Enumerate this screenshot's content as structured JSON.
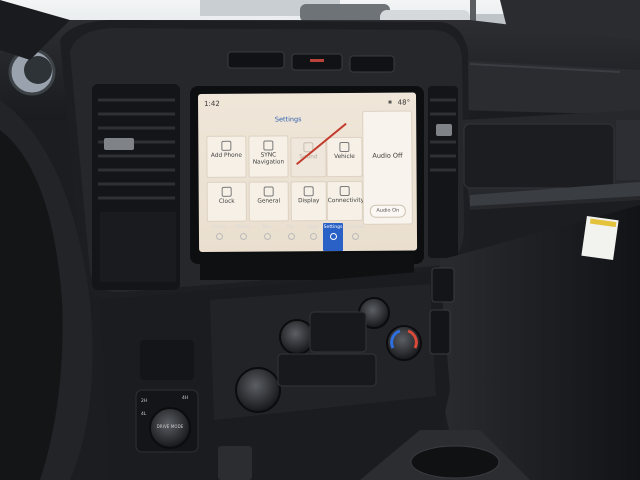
{
  "screen": {
    "time": "1:42",
    "temperature": "48°",
    "title": "Settings",
    "tiles": [
      {
        "label": "Add Phone",
        "state": "active",
        "icon": "phone-plus-icon"
      },
      {
        "label": "SYNC Navigation",
        "state": "active",
        "icon": "navigation-icon"
      },
      {
        "label": "Sound",
        "state": "dim",
        "icon": "sound-icon"
      },
      {
        "label": "Vehicle",
        "state": "active",
        "icon": "vehicle-icon"
      },
      {
        "label": "Clock",
        "state": "active",
        "icon": "clock-icon"
      },
      {
        "label": "General",
        "state": "active",
        "icon": "gear-icon"
      },
      {
        "label": "Display",
        "state": "active",
        "icon": "display-icon"
      },
      {
        "label": "Connectivity",
        "state": "active",
        "icon": "connectivity-icon"
      }
    ],
    "audio_panel": {
      "status": "Audio Off",
      "button": "Audio On"
    },
    "navbar": [
      {
        "label": "Audio",
        "icon": "music-note-icon",
        "active": false
      },
      {
        "label": "Phone",
        "icon": "phone-icon",
        "active": false
      },
      {
        "label": "Nav",
        "icon": "navigation-arrow-icon",
        "active": false
      },
      {
        "label": "Fav",
        "icon": "star-icon",
        "active": false
      },
      {
        "label": "Apps",
        "icon": "apps-grid-icon",
        "active": false
      },
      {
        "label": "Settings",
        "icon": "gear-icon",
        "active": true
      },
      {
        "label": "Features",
        "icon": "features-icon",
        "active": false
      }
    ]
  },
  "physical_controls": {
    "drive_mode_label": "DRIVE MODE",
    "drive_positions": [
      "2H",
      "4H",
      "4L"
    ]
  },
  "colors": {
    "screen_bg": "#eee4d6",
    "accent": "#2a61c6",
    "dash": "#1f2023",
    "sky": "#e9eef2"
  }
}
